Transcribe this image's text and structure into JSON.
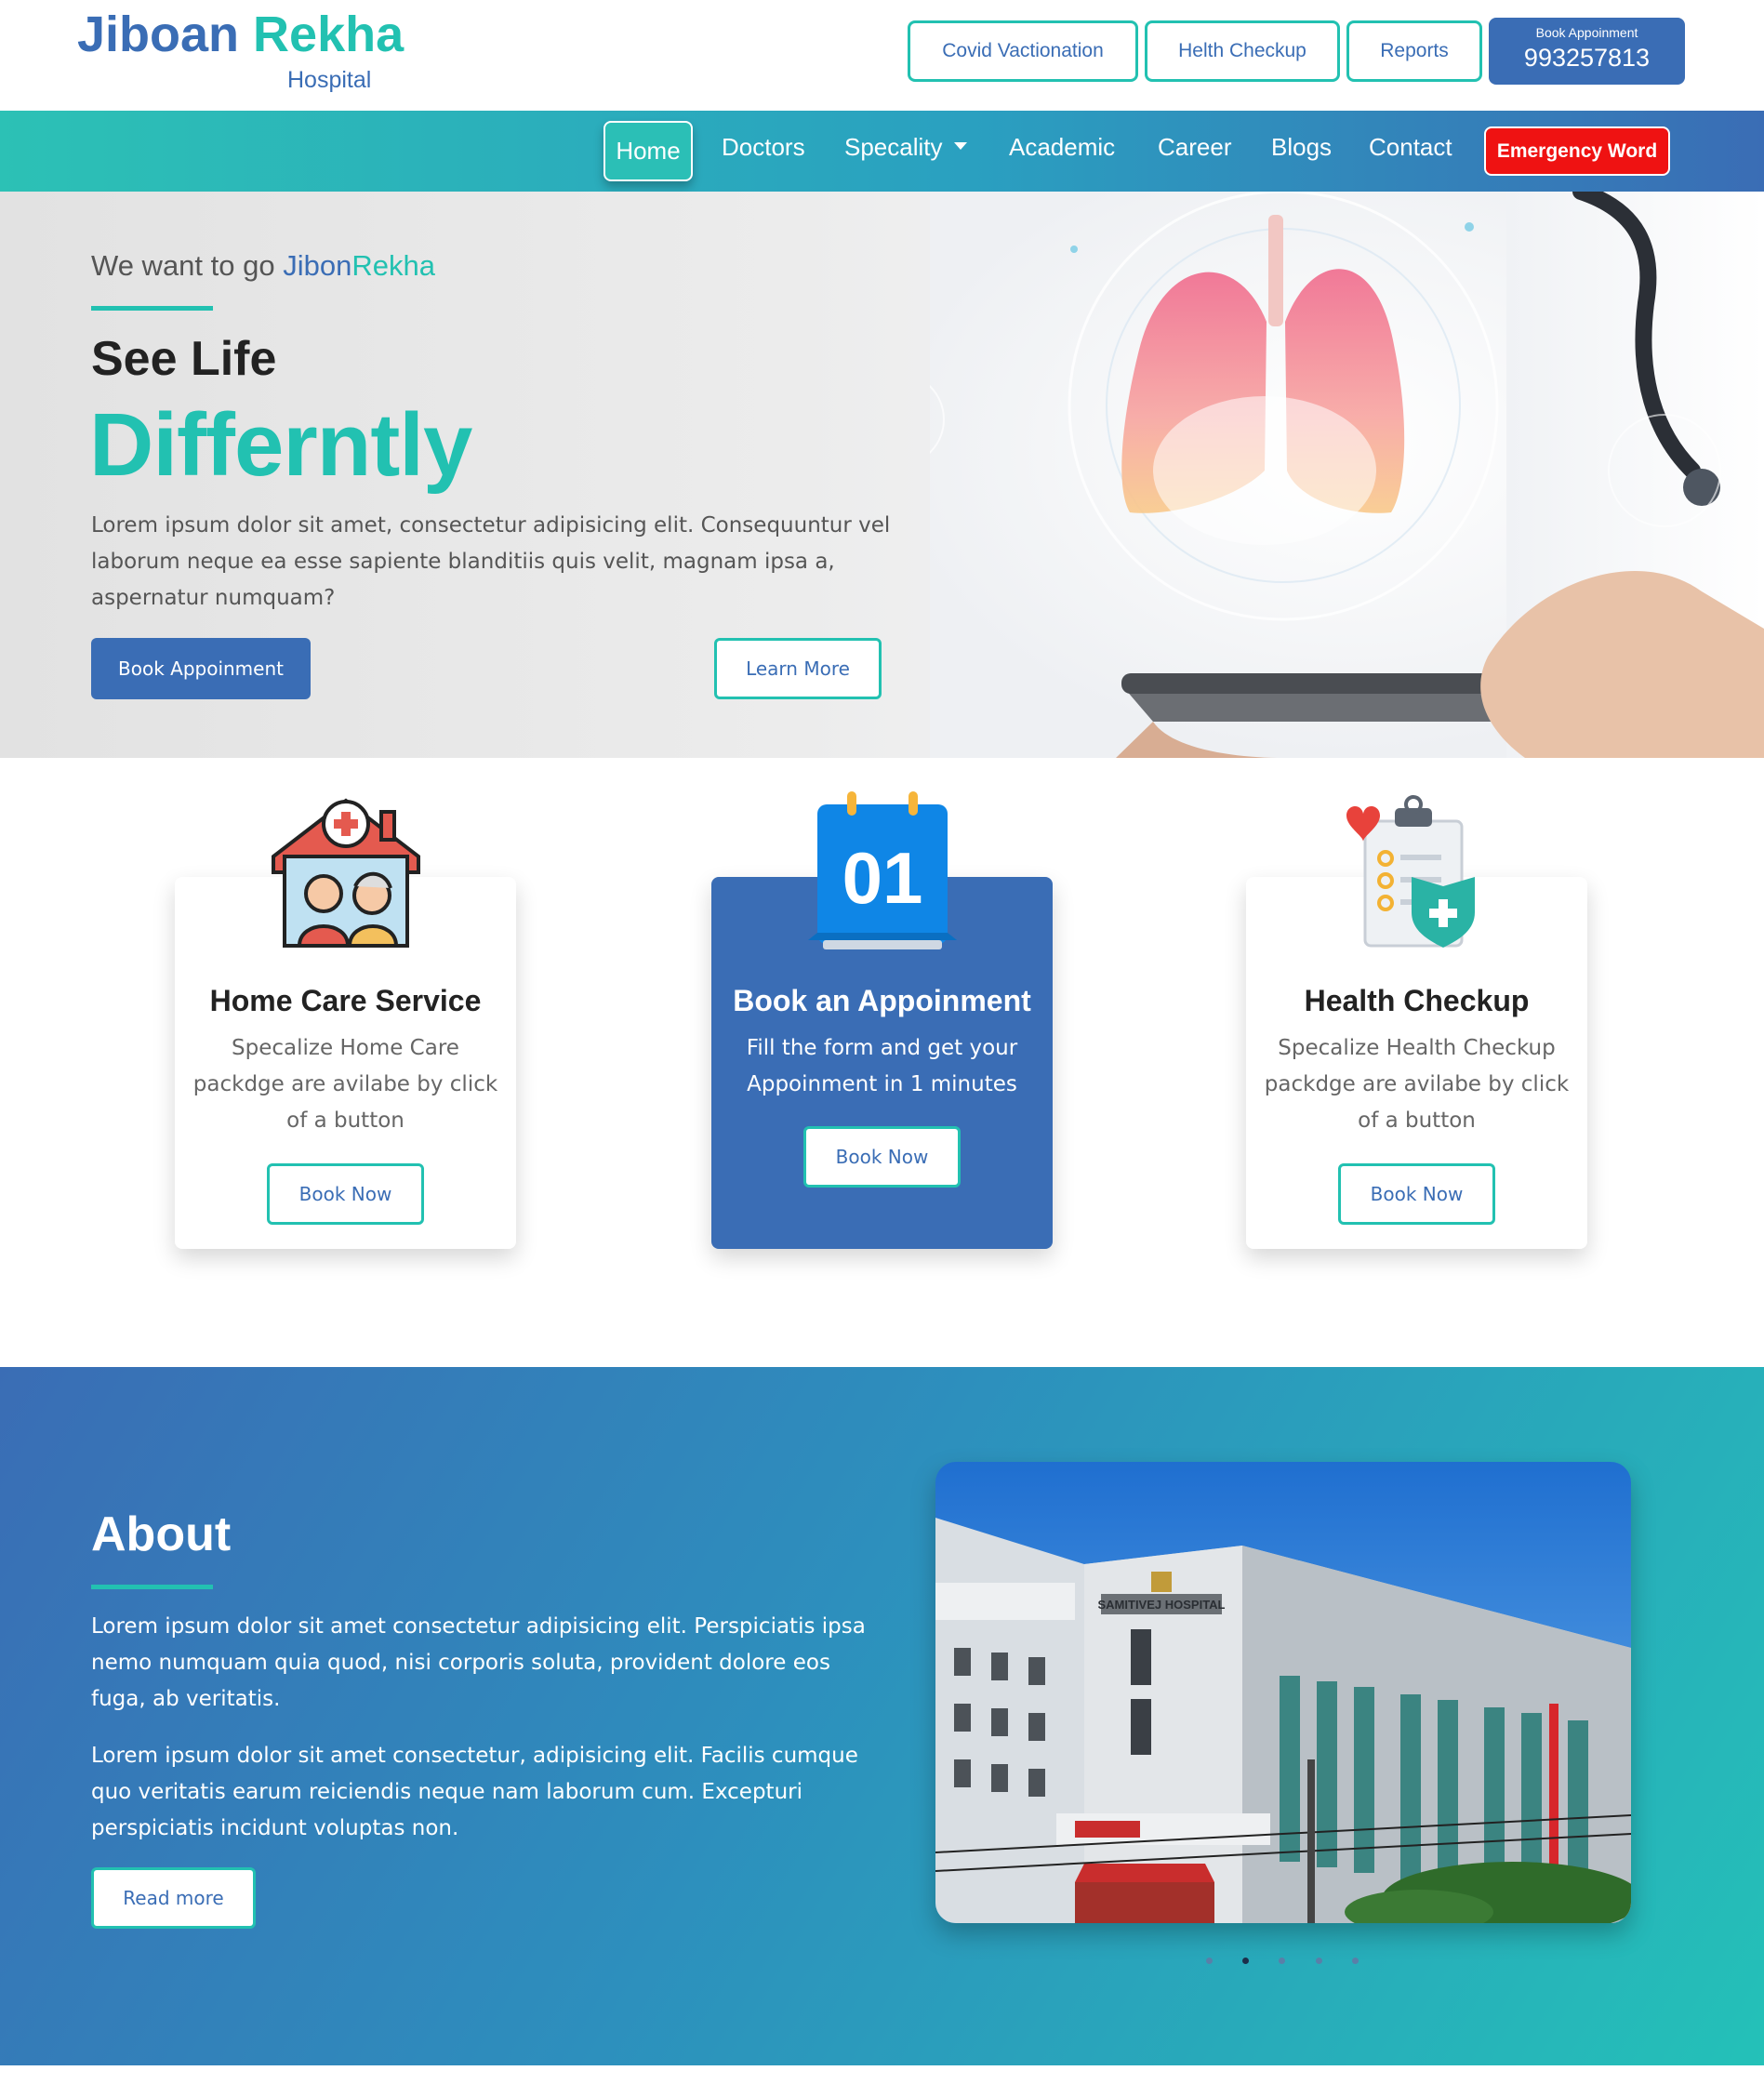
{
  "brand": {
    "name_part1": "Jiboan",
    "name_part2": "Rekha",
    "subtitle": "Hospital"
  },
  "top_buttons": [
    {
      "label": "Covid Vactionation"
    },
    {
      "label": "Helth Checkup"
    },
    {
      "label": "Reports"
    }
  ],
  "book_appointment_top": {
    "label": "Book Appoinment",
    "phone": "993257813"
  },
  "nav": {
    "items": [
      "Home",
      "Doctors",
      "Specality",
      "Academic",
      "Career",
      "Blogs",
      "Contact"
    ],
    "active": "Home",
    "emergency_label": "Emergency Word"
  },
  "hero": {
    "tagline_prefix": "We want to go",
    "tagline_part1": "Jibon",
    "tagline_part2": "Rekha",
    "heading_line1": "See Life",
    "heading_line2": "Differntly",
    "paragraph": "Lorem ipsum dolor sit amet, consectetur adipisicing elit. Consequuntur vel laborum neque ea esse sapiente blanditiis quis velit, magnam ipsa a, aspernatur numquam?",
    "book_label": "Book Appoinment",
    "learn_label": "Learn More"
  },
  "cards": [
    {
      "title": "Home Care Service",
      "desc": "Specalize Home Care packdge are avilabe by click of a button",
      "button": "Book Now",
      "icon": "home-care-icon"
    },
    {
      "title": "Book an Appoinment",
      "desc": "Fill the form and get your Appoinment in 1 minutes",
      "button": "Book Now",
      "icon": "calendar-icon",
      "calendar_day": "01"
    },
    {
      "title": "Health Checkup",
      "desc": "Specalize Health Checkup packdge are avilabe by click of a button",
      "button": "Book Now",
      "icon": "health-checklist-icon"
    }
  ],
  "about": {
    "title": "About",
    "paragraph1": "Lorem ipsum dolor sit amet consectetur adipisicing elit. Perspiciatis ipsa nemo numquam quia quod, nisi corporis soluta, provident dolore eos fuga, ab veritatis.",
    "paragraph2": "Lorem ipsum dolor sit amet consectetur, adipisicing elit. Facilis cumque quo veritatis earum reiciendis neque nam laborum cum. Excepturi perspiciatis incidunt voluptas non.",
    "read_more_label": "Read more",
    "image_sign": "SAMITIVEJ HOSPITAL",
    "carousel": {
      "total": 5,
      "active_index": 1
    }
  },
  "colors": {
    "brand_blue": "#3a6db5",
    "brand_teal": "#22c1b1",
    "emergency_red": "#ef1212"
  }
}
